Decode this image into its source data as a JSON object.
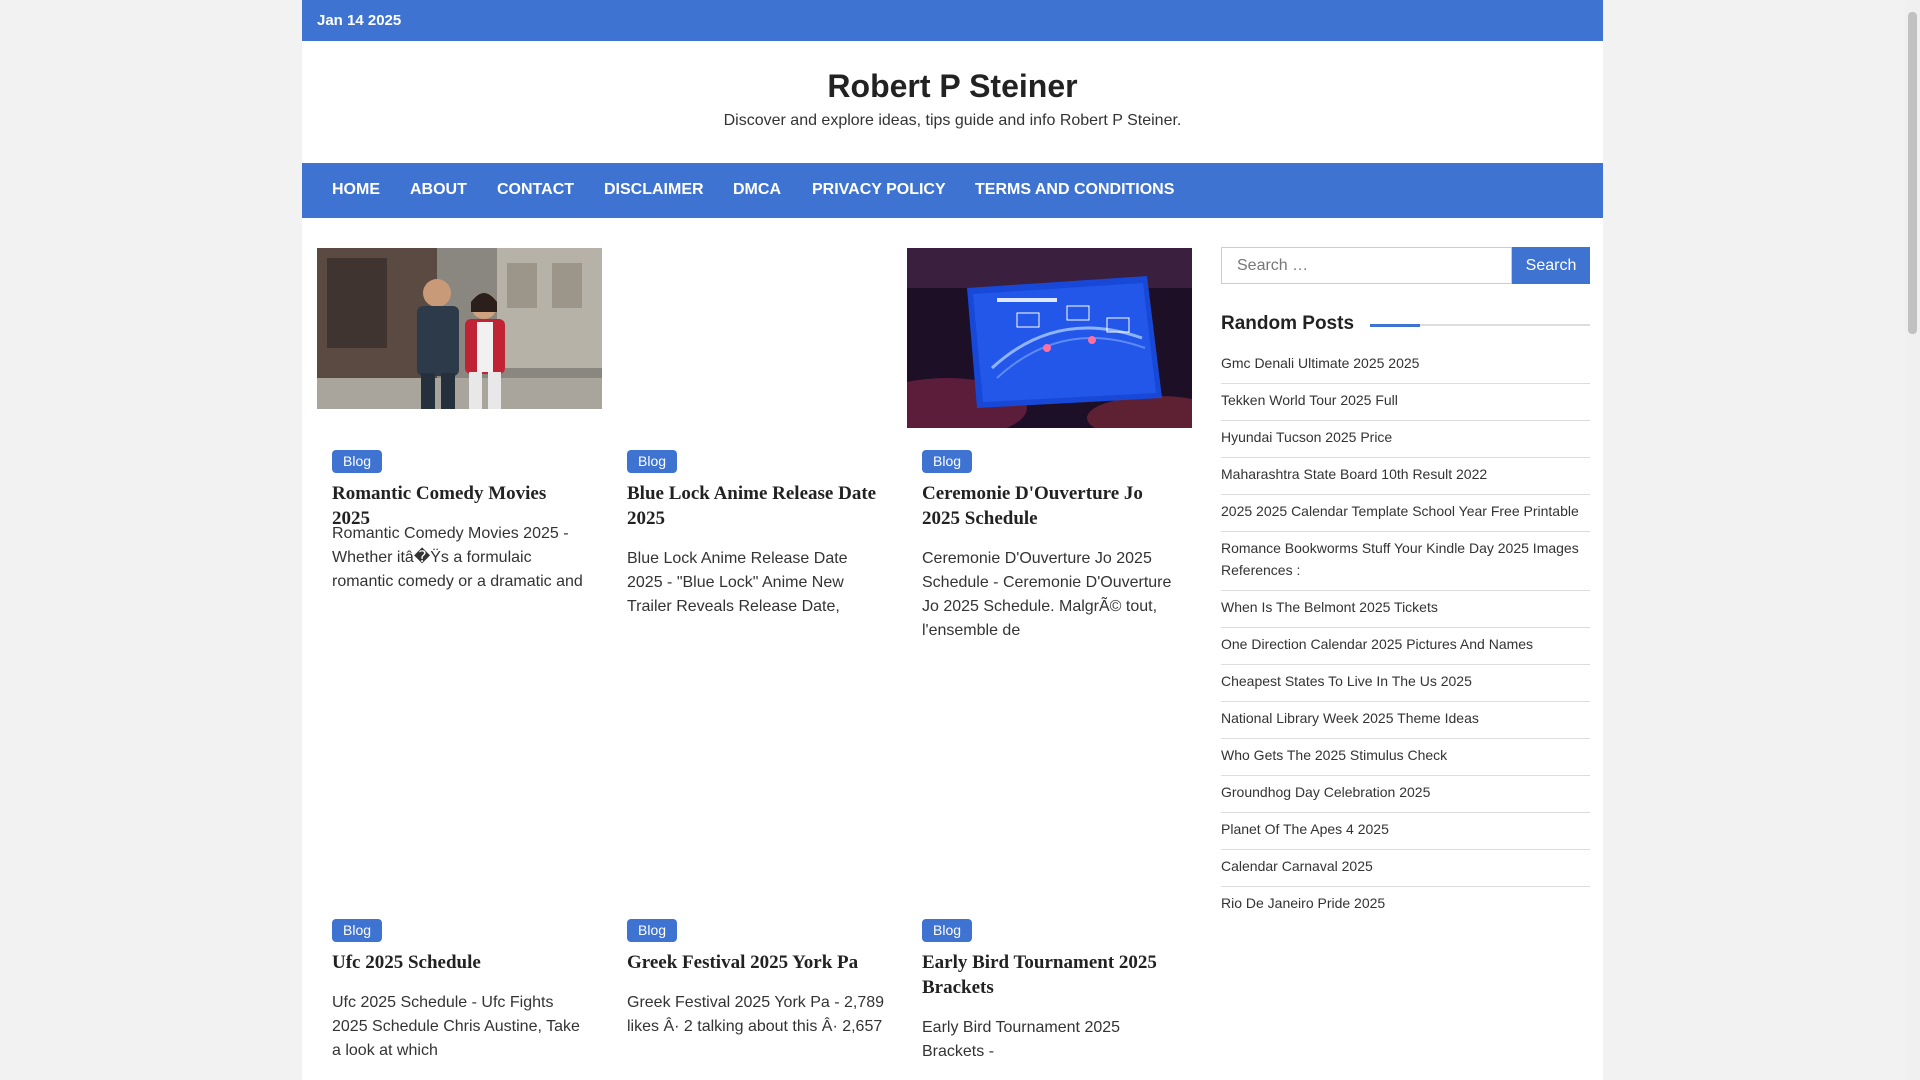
{
  "topbar": {
    "date": "Jan 14 2025"
  },
  "site": {
    "title": "Robert P Steiner",
    "description": "Discover and explore ideas, tips guide and info Robert P Steiner."
  },
  "nav": [
    "HOME",
    "ABOUT",
    "CONTACT",
    "DISCLAIMER",
    "DMCA",
    "PRIVACY POLICY",
    "TERMS AND CONDITIONS"
  ],
  "posts": [
    {
      "category": "Blog",
      "title": "Romantic Comedy Movies 2025",
      "excerpt": "Romantic Comedy Movies 2025 - Whether itâ�Ÿs a formulaic romantic comedy or a dramatic and",
      "image": "couple-walking-street-photo"
    },
    {
      "category": "Blog",
      "title": "Blue Lock Anime Release Date 2025",
      "excerpt": "Blue Lock Anime Release Date 2025 - \"Blue Lock\" Anime New Trailer Reveals Release Date,",
      "image": ""
    },
    {
      "category": "Blog",
      "title": "Ceremonie D'Ouverture Jo 2025 Schedule",
      "excerpt": "Ceremonie D'Ouverture Jo 2025 Schedule - Ceremonie D'Ouverture Jo 2025 Schedule. MalgrÃ© tout, l'ensemble de",
      "image": "ceremony-stage-screen-photo"
    },
    {
      "category": "Blog",
      "title": "Ufc 2025 Schedule",
      "excerpt": "Ufc 2025 Schedule - Ufc Fights 2025 Schedule Chris Austine, Take a look at which",
      "image": ""
    },
    {
      "category": "Blog",
      "title": "Greek Festival 2025 York Pa",
      "excerpt": "Greek Festival 2025 York Pa - 2,789 likes Â· 2 talking about this Â· 2,657",
      "image": ""
    },
    {
      "category": "Blog",
      "title": "Early Bird Tournament 2025 Brackets",
      "excerpt": "Early Bird Tournament 2025 Brackets -",
      "image": ""
    }
  ],
  "search": {
    "placeholder": "Search …",
    "button": "Search"
  },
  "random_posts": {
    "heading": "Random Posts",
    "items": [
      "Gmc Denali Ultimate 2025 2025",
      "Tekken World Tour 2025 Full",
      "Hyundai Tucson 2025 Price",
      "Maharashtra State Board 10th Result 2022",
      "2025 2025 Calendar Template School Year Free Printable",
      "Romance Bookworms Stuff Your Kindle Day 2025 Images References :",
      "When Is The Belmont 2025 Tickets",
      "One Direction Calendar 2025 Pictures And Names",
      "Cheapest States To Live In The Us 2025",
      "National Library Week 2025 Theme Ideas",
      "Who Gets The 2025 Stimulus Check",
      "Groundhog Day Celebration 2025",
      "Planet Of The Apes 4 2025",
      "Calendar Carnaval 2025",
      "Rio De Janeiro Pride 2025"
    ]
  },
  "colors": {
    "accent": "#3f73d1"
  }
}
